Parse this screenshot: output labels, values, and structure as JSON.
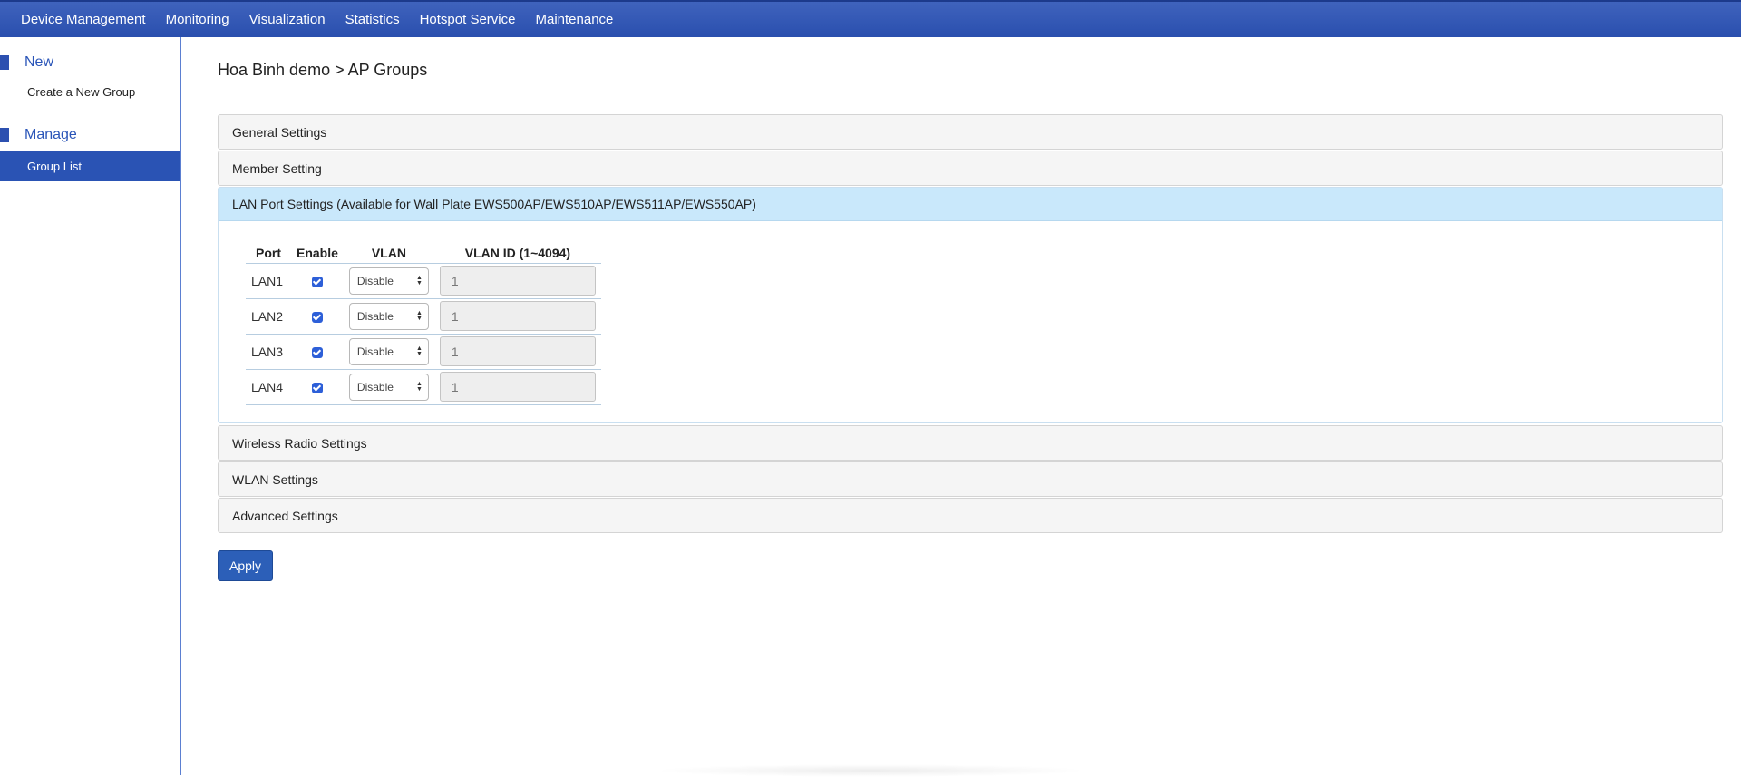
{
  "topnav": {
    "items": [
      "Device Management",
      "Monitoring",
      "Visualization",
      "Statistics",
      "Hotspot Service",
      "Maintenance"
    ]
  },
  "sidebar": {
    "new_title": "New",
    "create_link": "Create a New Group",
    "manage_title": "Manage",
    "group_list_link": "Group List"
  },
  "breadcrumb": "Hoa Binh demo > AP Groups",
  "panels": {
    "general": "General Settings",
    "member": "Member Setting",
    "lan": "LAN Port Settings (Available for Wall Plate EWS500AP/EWS510AP/EWS511AP/EWS550AP)",
    "wireless": "Wireless Radio Settings",
    "wlan": "WLAN Settings",
    "advanced": "Advanced Settings"
  },
  "lan_table": {
    "headers": {
      "port": "Port",
      "enable": "Enable",
      "vlan": "VLAN",
      "vlan_id": "VLAN ID (1~4094)"
    },
    "rows": [
      {
        "port": "LAN1",
        "enabled": true,
        "vlan": "Disable",
        "vlan_id": "1"
      },
      {
        "port": "LAN2",
        "enabled": true,
        "vlan": "Disable",
        "vlan_id": "1"
      },
      {
        "port": "LAN3",
        "enabled": true,
        "vlan": "Disable",
        "vlan_id": "1"
      },
      {
        "port": "LAN4",
        "enabled": true,
        "vlan": "Disable",
        "vlan_id": "1"
      }
    ]
  },
  "apply_label": "Apply",
  "colors": {
    "nav_bg": "#2f55b4",
    "accent": "#2a53b4",
    "open_panel": "#c9e8fb"
  }
}
